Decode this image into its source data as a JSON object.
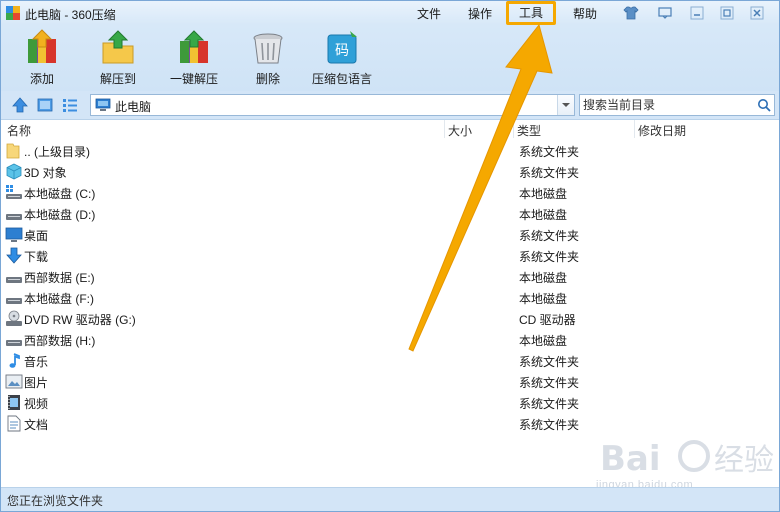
{
  "window": {
    "title": "此电脑 - 360压缩"
  },
  "menu": {
    "file": "文件",
    "operate": "操作",
    "tools": "工具",
    "help": "帮助"
  },
  "toolbar": {
    "add": "添加",
    "extract_to": "解压到",
    "one_click": "一键解压",
    "delete": "删除",
    "encoding": "压缩包语言"
  },
  "address": {
    "path": "此电脑"
  },
  "search": {
    "placeholder": "搜索当前目录"
  },
  "columns": {
    "name": "名称",
    "size": "大小",
    "type": "类型",
    "modified": "修改日期"
  },
  "rows": [
    {
      "name": ".. (上级目录)",
      "type": "系统文件夹",
      "icon": "folder-up-icon"
    },
    {
      "name": "3D 对象",
      "type": "系统文件夹",
      "icon": "3d-objects-icon"
    },
    {
      "name": "本地磁盘 (C:)",
      "type": "本地磁盘",
      "icon": "windows-drive-icon"
    },
    {
      "name": "本地磁盘 (D:)",
      "type": "本地磁盘",
      "icon": "drive-icon"
    },
    {
      "name": "桌面",
      "type": "系统文件夹",
      "icon": "desktop-icon"
    },
    {
      "name": "下载",
      "type": "系统文件夹",
      "icon": "download-icon"
    },
    {
      "name": "西部数据 (E:)",
      "type": "本地磁盘",
      "icon": "drive-icon"
    },
    {
      "name": "本地磁盘 (F:)",
      "type": "本地磁盘",
      "icon": "drive-icon"
    },
    {
      "name": "DVD RW 驱动器 (G:)",
      "type": "CD 驱动器",
      "icon": "dvd-drive-icon"
    },
    {
      "name": "西部数据 (H:)",
      "type": "本地磁盘",
      "icon": "drive-icon"
    },
    {
      "name": "音乐",
      "type": "系统文件夹",
      "icon": "music-icon"
    },
    {
      "name": "图片",
      "type": "系统文件夹",
      "icon": "pictures-icon"
    },
    {
      "name": "视频",
      "type": "系统文件夹",
      "icon": "videos-icon"
    },
    {
      "name": "文档",
      "type": "系统文件夹",
      "icon": "documents-icon"
    }
  ],
  "status": {
    "text": "您正在浏览文件夹"
  },
  "watermark": {
    "text": "jingyan.baidu.com"
  },
  "colors": {
    "accent": "#f5a800",
    "chrome": "#d3e5f7"
  }
}
